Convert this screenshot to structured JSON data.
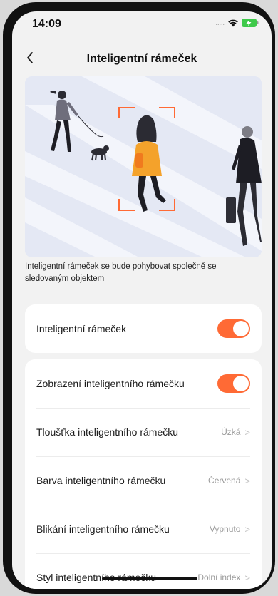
{
  "status": {
    "time": "14:09",
    "signal": "....."
  },
  "nav": {
    "title": "Inteligentní rámeček"
  },
  "description": "Inteligentní rámeček se bude pohybovat společně se sledovaným objektem",
  "card1": {
    "label": "Inteligentní rámeček",
    "enabled": true
  },
  "settings": [
    {
      "label": "Zobrazení inteligentního rámečku",
      "type": "toggle",
      "enabled": true
    },
    {
      "label": "Tloušťka inteligentního rámečku",
      "value": "Úzká"
    },
    {
      "label": "Barva inteligentního rámečku",
      "value": "Červená"
    },
    {
      "label": "Blikání inteligentního rámečku",
      "value": "Vypnuto"
    },
    {
      "label": "Styl inteligentního rámečku",
      "value": "Dolní index"
    }
  ],
  "colors": {
    "accent": "#ff6a35",
    "background": "#f2f2f2",
    "illustration_bg": "#e4e8f4"
  }
}
